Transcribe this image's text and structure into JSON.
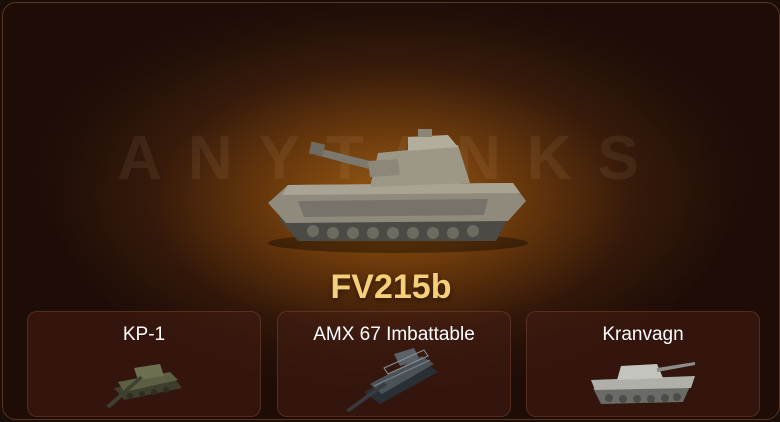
{
  "watermark": "ANYTANKS",
  "featured": {
    "name": "FV215b",
    "icon": "heavy-tank-icon"
  },
  "rewards": [
    {
      "name": "KP-1",
      "icon": "olive-tank-icon"
    },
    {
      "name": "AMX 67 Imbattable",
      "icon": "dark-tank-icon"
    },
    {
      "name": "Kranvagn",
      "icon": "grey-tank-icon"
    }
  ],
  "colors": {
    "title": "#f6cf7a",
    "glow": "#8a4f0c",
    "card_bg": "#461e12"
  }
}
